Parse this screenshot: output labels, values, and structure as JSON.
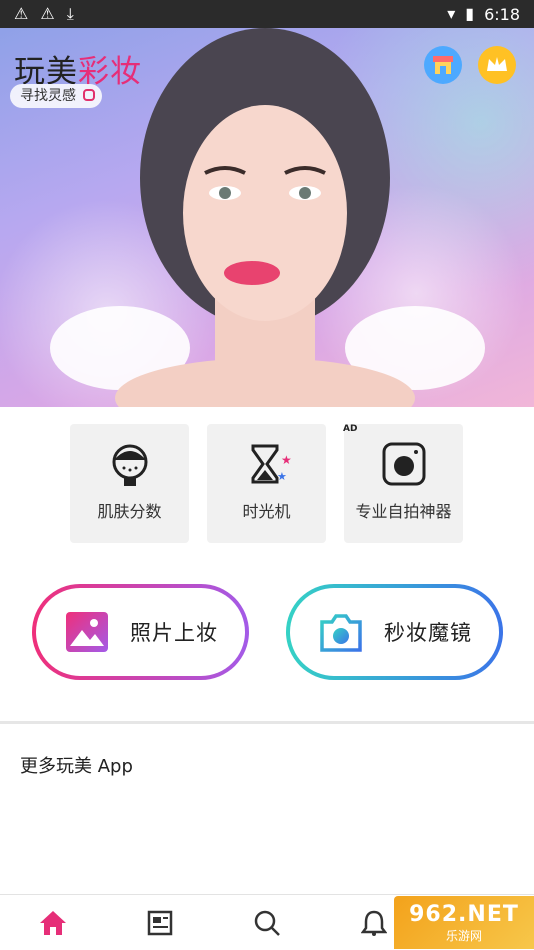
{
  "status_bar": {
    "time": "6:18"
  },
  "hero": {
    "brand_part1": "玩美",
    "brand_part2": "彩妆",
    "tagline": "寻找灵感",
    "icons": [
      "instagram-icon",
      "store-icon",
      "crown-icon"
    ]
  },
  "features": [
    {
      "label": "肌肤分数",
      "icon": "face-scan-icon"
    },
    {
      "label": "时光机",
      "icon": "hourglass-icon"
    },
    {
      "label": "专业自拍神器",
      "icon": "camera-app-icon"
    }
  ],
  "ad_badge": "AD",
  "actions": {
    "photo_makeup": {
      "label": "照片上妆",
      "icon": "photo-icon"
    },
    "instant_mirror": {
      "label": "秒妆魔镜",
      "icon": "camera-icon"
    }
  },
  "more_section": {
    "title": "更多玩美 App"
  },
  "bottom_nav": {
    "items": [
      "home-icon",
      "news-icon",
      "search-icon",
      "bell-icon"
    ]
  },
  "watermark": {
    "big": "962.NET",
    "small": "乐游网"
  },
  "colors": {
    "brand_pink": "#e62e78",
    "gradient_pink": "#ef2f7a",
    "gradient_purple": "#a35be8",
    "gradient_teal": "#35d2c5",
    "gradient_blue": "#3b74e8",
    "home_active": "#e62e78"
  }
}
